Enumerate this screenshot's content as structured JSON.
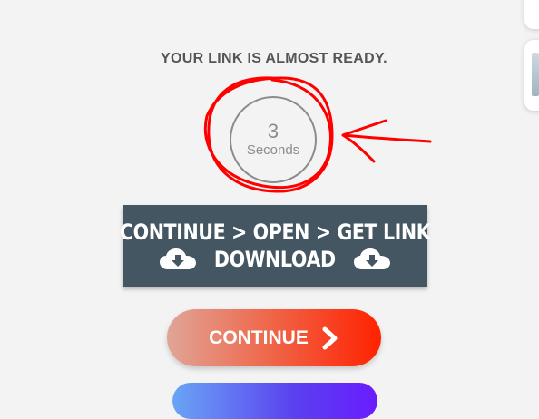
{
  "countdown": {
    "heading": "YOUR LINK IS ALMOST READY.",
    "value": "3",
    "unit": "Seconds"
  },
  "banner": {
    "line1": "Continue > Open > Get Link",
    "line2": "Download",
    "icon": "cloud-download-icon",
    "background": "#435662"
  },
  "buttons": {
    "continue_label": "CONTINUE",
    "continue_icon": "chevron-right-icon"
  },
  "annotation": {
    "color": "#ff0000",
    "icons": [
      "hand-drawn-circle",
      "hand-drawn-arrow"
    ]
  }
}
